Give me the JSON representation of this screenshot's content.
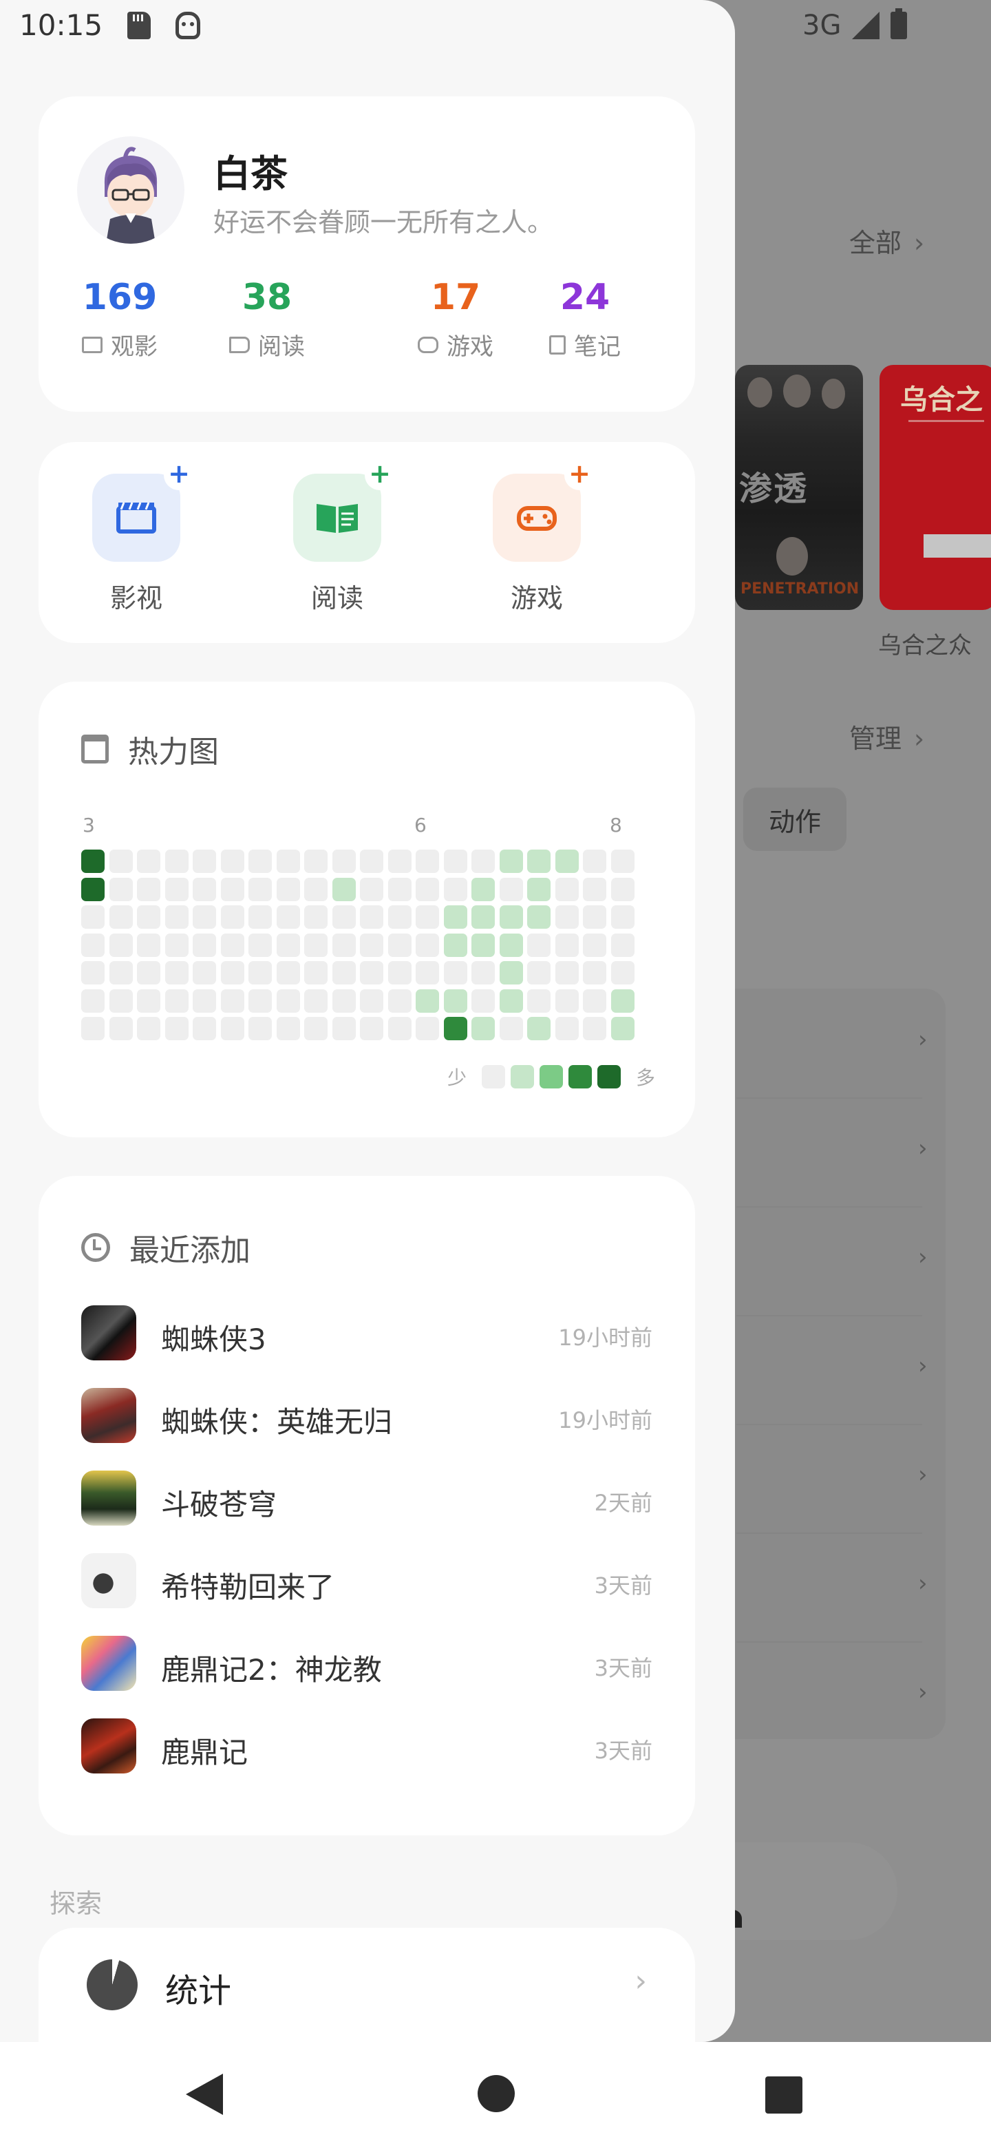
{
  "status_bar": {
    "time": "10:15",
    "network": "3G"
  },
  "profile": {
    "name": "白茶",
    "motto": "好运不会眷顾一无所有之人。",
    "stats": [
      {
        "value": "169",
        "label": "观影",
        "icon": "film-icon",
        "color": "#2f68e0"
      },
      {
        "value": "38",
        "label": "阅读",
        "icon": "book-icon",
        "color": "#27a45a"
      },
      {
        "value": "17",
        "label": "游戏",
        "icon": "gamepad-icon",
        "color": "#e8621c"
      },
      {
        "value": "24",
        "label": "笔记",
        "icon": "note-icon",
        "color": "#8d36d9"
      }
    ]
  },
  "quick_add": [
    {
      "label": "影视",
      "icon": "clapperboard-icon",
      "plus": "+"
    },
    {
      "label": "阅读",
      "icon": "book-open-icon",
      "plus": "+"
    },
    {
      "label": "游戏",
      "icon": "gamepad-icon",
      "plus": "+"
    }
  ],
  "heatmap": {
    "title": "热力图",
    "month_labels": [
      "3",
      "6",
      "8"
    ],
    "legend_less": "少",
    "legend_more": "多",
    "level_colors": [
      "#eeeeee",
      "#c6e6c9",
      "#7ccb86",
      "#2f8a3c",
      "#1e6a2a"
    ]
  },
  "recent": {
    "title": "最近添加",
    "items": [
      {
        "title": "蜘蛛侠3",
        "time": "19小时前"
      },
      {
        "title": "蜘蛛侠：英雄无归",
        "time": "19小时前"
      },
      {
        "title": "斗破苍穹",
        "time": "2天前"
      },
      {
        "title": "希特勒回来了",
        "time": "3天前"
      },
      {
        "title": "鹿鼎记2：神龙教",
        "time": "3天前"
      },
      {
        "title": "鹿鼎记",
        "time": "3天前"
      }
    ]
  },
  "explore": {
    "label": "探索",
    "stats_item": "统计"
  },
  "background": {
    "all_link": "全部",
    "manage_link": "管理",
    "poster_caption": "乌合之众",
    "poster_title": "乌合之",
    "chip": "动作"
  }
}
